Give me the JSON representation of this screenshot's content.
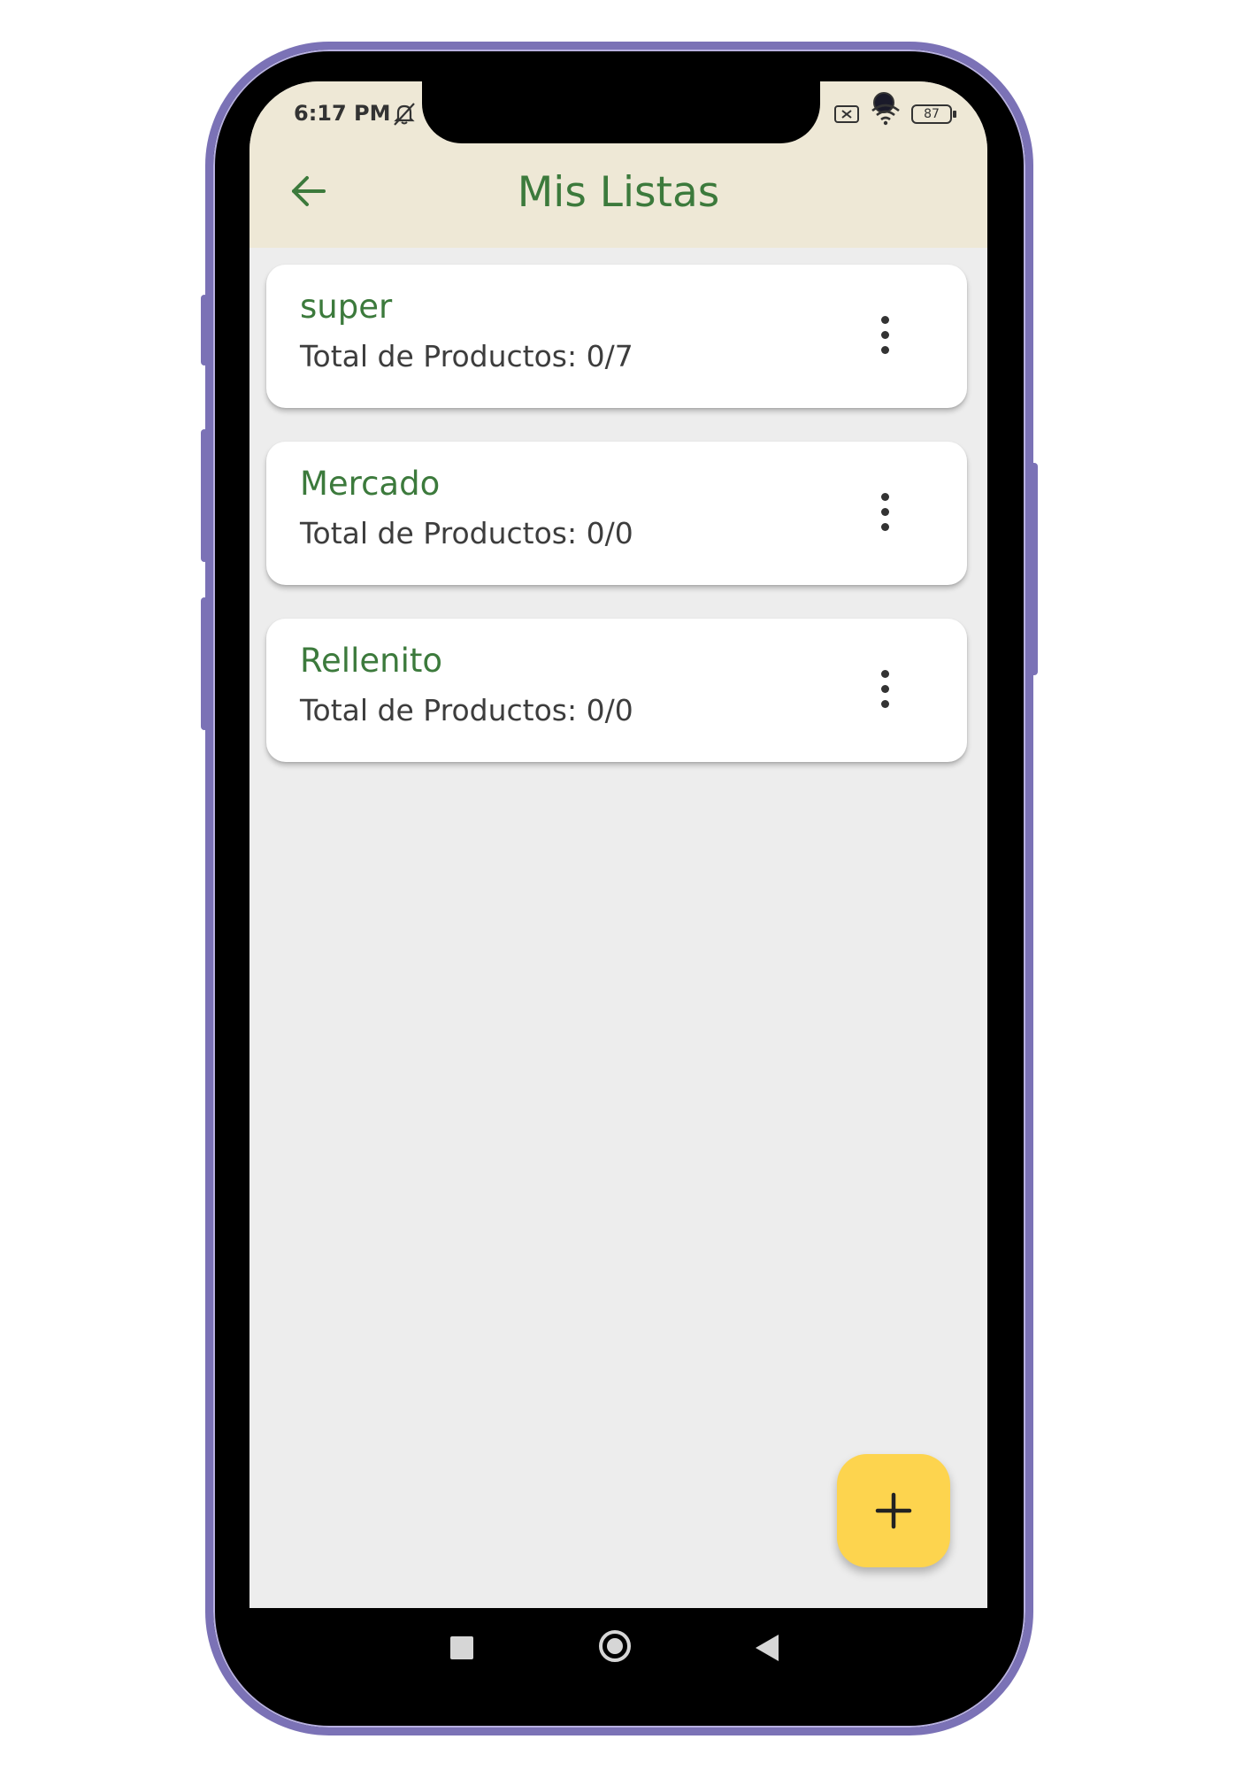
{
  "status_bar": {
    "time": "6:17 PM",
    "battery": "87",
    "icons": [
      "bell-off-icon",
      "sim-off-icon",
      "wifi-icon",
      "battery-icon"
    ]
  },
  "app_bar": {
    "title": "Mis Listas",
    "back_icon": "arrow-left-icon"
  },
  "lists": [
    {
      "name": "super",
      "total": "Total de Productos: 0/7"
    },
    {
      "name": "Mercado",
      "total": "Total de Productos: 0/0"
    },
    {
      "name": "Rellenito",
      "total": "Total de Productos: 0/0"
    }
  ],
  "fab": {
    "icon": "plus-icon"
  },
  "nav_bar": {
    "icons": [
      "recents-square-icon",
      "home-circle-icon",
      "back-triangle-icon"
    ]
  },
  "colors": {
    "app_bar_bg": "#eee8d6",
    "accent_green": "#3c7a3c",
    "fab_yellow": "#fdd44e",
    "screen_bg": "#ededed",
    "phone_frame": "#7b72b6"
  }
}
